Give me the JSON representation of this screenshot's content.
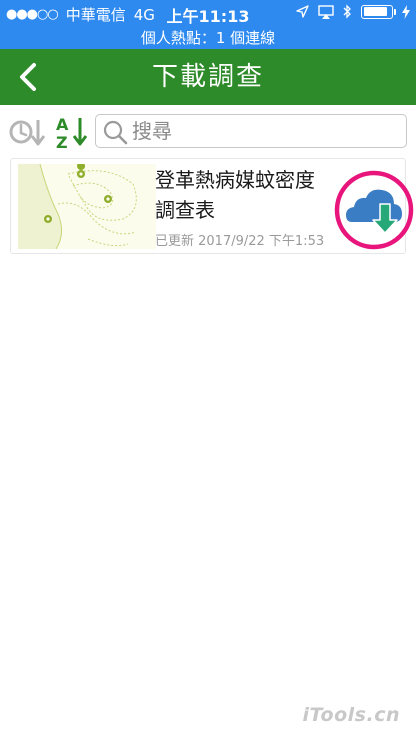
{
  "status_bar": {
    "carrier": "中華電信",
    "network": "4G",
    "time": "上午11:13",
    "battery_level": 0.95
  },
  "hotspot_text": "個人熱點：1 個連線",
  "nav": {
    "title": "下載調查",
    "back_icon": "chevron-left-icon"
  },
  "toolbar": {
    "sort_time_icon": "clock-sort-icon",
    "sort_alpha_icon": "az-sort-icon",
    "search_placeholder": "搜尋",
    "search_value": ""
  },
  "surveys": [
    {
      "title": "登革熱病媒蚊密度調查表",
      "updated_label": "已更新 2017/9/22 下午1:53",
      "thumbnail_icon": "map-thumbnail",
      "action_icon": "cloud-download-icon",
      "colors": {
        "cloud": "#3b7dc4",
        "arrow": "#27a878",
        "highlight_ring": "#e8157c"
      }
    }
  ],
  "watermark": "iTools.cn",
  "colors": {
    "status_bar": "#2f8af0",
    "nav_bar": "#2e8b2a",
    "sort_icon": "#2e8b2a"
  }
}
